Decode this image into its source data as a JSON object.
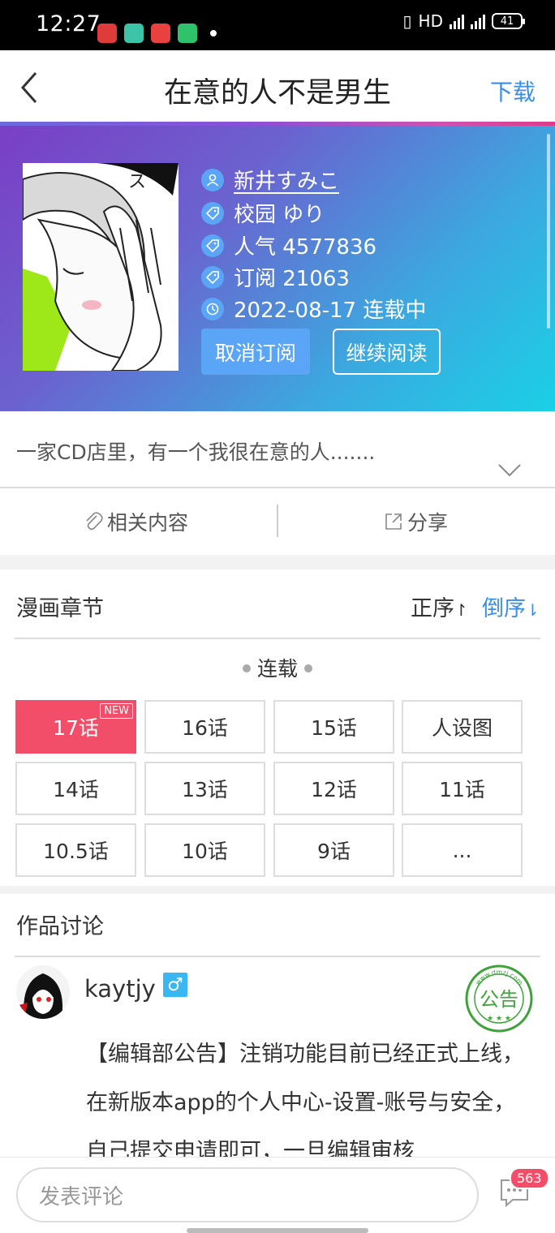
{
  "status_bar": {
    "time": "12:27",
    "network": "HD",
    "signal1": "4G",
    "signal2": "4G",
    "battery": "41"
  },
  "nav": {
    "title": "在意的人不是男生",
    "download": "下载"
  },
  "comic": {
    "author": "新井すみこ",
    "tags": "校园 ゆり",
    "popularity": "人气 4577836",
    "subscriptions": "订阅 21063",
    "update": "2022-08-17 连载中",
    "unsubscribe_label": "取消订阅",
    "continue_label": "继续阅读",
    "description": "一家CD店里，有一个我很在意的人.......",
    "accent_color": "#5aa5f5"
  },
  "actions": {
    "related": "相关内容",
    "share": "分享"
  },
  "chapters": {
    "section_title": "漫画章节",
    "order_asc": "正序",
    "order_desc": "倒序",
    "group_label": "连载",
    "new_badge": "NEW",
    "items": [
      "17话",
      "16话",
      "15话",
      "人设图",
      "14话",
      "13话",
      "12话",
      "11话",
      "10.5话",
      "10话",
      "9话",
      "..."
    ],
    "active_color": "#f24e69"
  },
  "discussion": {
    "section_title": "作品讨论",
    "username": "kaytjy",
    "gender_symbol": "♂",
    "stamp_text": "公告",
    "stamp_url": "www.dmzj.com",
    "post_text": "【编辑部公告】注销功能目前已经正式上线，在新版本app的个人中心-设置-账号与安全，自己提交申请即可，一旦编辑审核"
  },
  "bottom": {
    "comment_placeholder": "发表评论",
    "comment_count": "563"
  }
}
